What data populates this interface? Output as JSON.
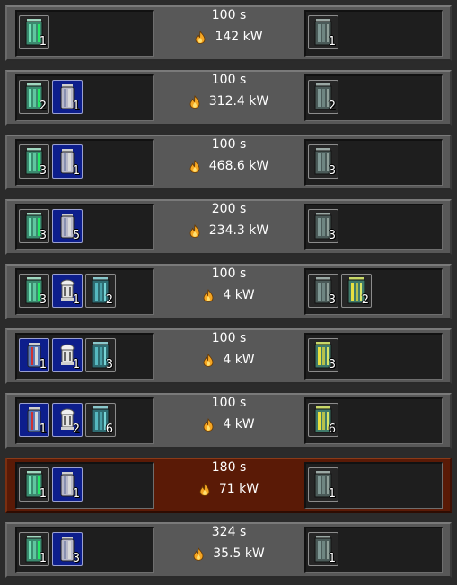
{
  "recipes": [
    {
      "time": "100 s",
      "power": "142 kW",
      "highlighted": false,
      "inputs": [
        {
          "icon": "green-fuel-cell-icon",
          "count": "1"
        }
      ],
      "outputs": [
        {
          "icon": "depleted-fuel-cell-icon",
          "count": "1"
        }
      ]
    },
    {
      "time": "100 s",
      "power": "312.4 kW",
      "highlighted": false,
      "inputs": [
        {
          "icon": "green-fuel-cell-icon",
          "count": "2"
        },
        {
          "icon": "blue-fuel-canister-icon",
          "count": "1"
        }
      ],
      "outputs": [
        {
          "icon": "depleted-fuel-cell-icon",
          "count": "2"
        }
      ]
    },
    {
      "time": "100 s",
      "power": "468.6 kW",
      "highlighted": false,
      "inputs": [
        {
          "icon": "green-fuel-cell-icon",
          "count": "3"
        },
        {
          "icon": "blue-fuel-canister-icon",
          "count": "1"
        }
      ],
      "outputs": [
        {
          "icon": "depleted-fuel-cell-icon",
          "count": "3"
        }
      ]
    },
    {
      "time": "200 s",
      "power": "234.3 kW",
      "highlighted": false,
      "inputs": [
        {
          "icon": "green-fuel-cell-icon",
          "count": "3"
        },
        {
          "icon": "blue-fuel-canister-icon",
          "count": "5"
        }
      ],
      "outputs": [
        {
          "icon": "depleted-fuel-cell-icon",
          "count": "3"
        }
      ]
    },
    {
      "time": "100 s",
      "power": "4 kW",
      "highlighted": false,
      "inputs": [
        {
          "icon": "green-fuel-cell-icon",
          "count": "3"
        },
        {
          "icon": "white-catalyst-canister-icon",
          "count": "1"
        },
        {
          "icon": "teal-fuel-cell-icon",
          "count": "2"
        }
      ],
      "outputs": [
        {
          "icon": "depleted-fuel-cell-icon",
          "count": "3"
        },
        {
          "icon": "yellow-fuel-cell-icon",
          "count": "2"
        }
      ]
    },
    {
      "time": "100 s",
      "power": "4 kW",
      "highlighted": false,
      "inputs": [
        {
          "icon": "red-core-canister-icon",
          "count": "1"
        },
        {
          "icon": "white-catalyst-canister-icon",
          "count": "1"
        },
        {
          "icon": "teal-fuel-cell-icon",
          "count": "3"
        }
      ],
      "outputs": [
        {
          "icon": "yellow-fuel-cell-icon",
          "count": "3"
        }
      ]
    },
    {
      "time": "100 s",
      "power": "4 kW",
      "highlighted": false,
      "inputs": [
        {
          "icon": "red-core-canister-icon",
          "count": "1"
        },
        {
          "icon": "white-catalyst-canister-icon",
          "count": "2"
        },
        {
          "icon": "teal-fuel-cell-icon",
          "count": "6"
        }
      ],
      "outputs": [
        {
          "icon": "yellow-fuel-cell-icon",
          "count": "6"
        }
      ]
    },
    {
      "time": "180 s",
      "power": "71 kW",
      "highlighted": true,
      "inputs": [
        {
          "icon": "green-fuel-cell-icon",
          "count": "1"
        },
        {
          "icon": "blue-fuel-canister-icon",
          "count": "1"
        }
      ],
      "outputs": [
        {
          "icon": "depleted-fuel-cell-icon",
          "count": "1"
        }
      ]
    },
    {
      "time": "324 s",
      "power": "35.5 kW",
      "highlighted": false,
      "inputs": [
        {
          "icon": "green-fuel-cell-icon",
          "count": "1"
        },
        {
          "icon": "blue-fuel-canister-icon",
          "count": "3"
        }
      ],
      "outputs": [
        {
          "icon": "depleted-fuel-cell-icon",
          "count": "1"
        }
      ]
    }
  ],
  "colors": {
    "row_bg": "#585858",
    "row_highlight_bg": "#5a1a06",
    "slot_bg": "#1e1e1e",
    "blue_item_bg": "#0d1e8c",
    "flame": "#f5a623",
    "text": "#ffffff"
  }
}
